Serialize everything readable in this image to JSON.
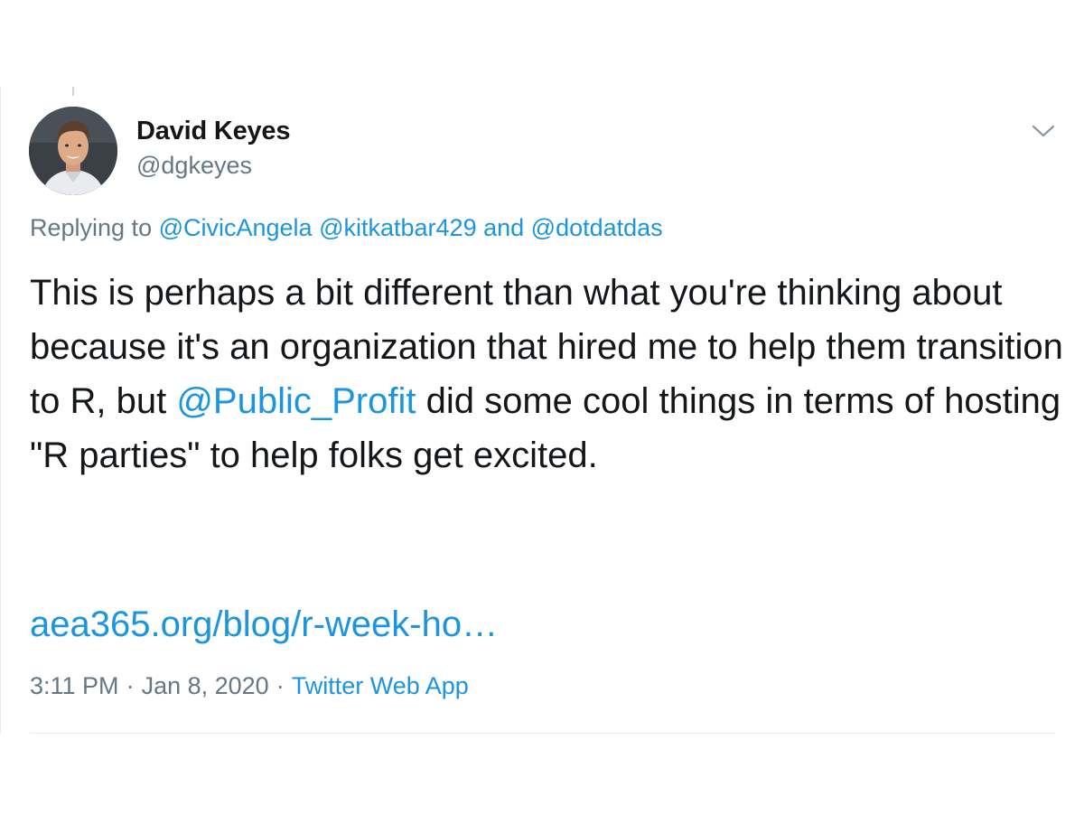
{
  "author": {
    "name": "David Keyes",
    "handle": "@dgkeyes"
  },
  "reply": {
    "prefix": "Replying to ",
    "mention_1": "@CivicAngela",
    "mention_2": "@kitkatbar429",
    "conjunction": " and ",
    "mention_3": "@dotdatdas"
  },
  "body": {
    "text_1": "This is perhaps a bit different than what you're thinking about because it's an organization that hired me to help them transition to R, but ",
    "mention": "@Public_Profit",
    "text_2": " did some cool things in terms of hosting \"R parties\" to help folks get excited."
  },
  "link": {
    "text": "aea365.org/blog/r-week-ho…"
  },
  "meta": {
    "time": "3:11 PM",
    "separator": "·",
    "date": "Jan 8, 2020",
    "source": "Twitter Web App"
  },
  "icons": {
    "menu": "chevron-down-icon",
    "avatar": "profile-photo"
  },
  "colors": {
    "text": "#14171a",
    "secondary": "#657786",
    "link": "#1b95e0",
    "divider": "#e6ecf0"
  }
}
